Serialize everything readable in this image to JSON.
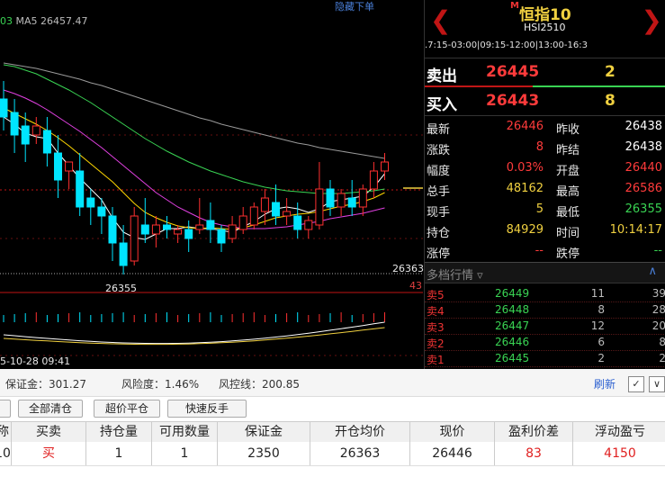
{
  "chart": {
    "ma_legend_prefix": "03",
    "ma_legend_ma5": "MA5 26457.47",
    "hide_link": "隐藏下单",
    "price_marker": "26363",
    "volume_marker": "43",
    "low_label": "26355",
    "datetime": "5-10-28 09:41",
    "colors": {
      "up": "#ff3030",
      "down": "#00e5ff",
      "ma5": "#ffffff",
      "ma10": "#ffd700",
      "ma20": "#e040e0",
      "ma40": "#39d353",
      "ma60": "#9a9a9a"
    }
  },
  "chart_data": {
    "type": "candlestick",
    "title": "恒指10",
    "ylim": [
      26320,
      26620
    ],
    "candles": [
      {
        "o": 26540,
        "h": 26560,
        "c": 26520,
        "l": 26505
      },
      {
        "o": 26525,
        "h": 26540,
        "c": 26500,
        "l": 26480
      },
      {
        "o": 26510,
        "h": 26525,
        "c": 26490,
        "l": 26470
      },
      {
        "o": 26500,
        "h": 26520,
        "c": 26510,
        "l": 26490
      },
      {
        "o": 26505,
        "h": 26520,
        "c": 26480,
        "l": 26465
      },
      {
        "o": 26480,
        "h": 26500,
        "c": 26450,
        "l": 26430
      },
      {
        "o": 26460,
        "h": 26470,
        "c": 26470,
        "l": 26440
      },
      {
        "o": 26460,
        "h": 26480,
        "c": 26420,
        "l": 26410
      },
      {
        "o": 26430,
        "h": 26440,
        "c": 26420,
        "l": 26400
      },
      {
        "o": 26420,
        "h": 26430,
        "c": 26410,
        "l": 26390
      },
      {
        "o": 26410,
        "h": 26420,
        "c": 26380,
        "l": 26360
      },
      {
        "o": 26380,
        "h": 26400,
        "c": 26355,
        "l": 26345
      },
      {
        "o": 26360,
        "h": 26420,
        "c": 26410,
        "l": 26355
      },
      {
        "o": 26400,
        "h": 26430,
        "c": 26390,
        "l": 26380
      },
      {
        "o": 26390,
        "h": 26410,
        "c": 26400,
        "l": 26375
      },
      {
        "o": 26400,
        "h": 26410,
        "c": 26395,
        "l": 26385
      },
      {
        "o": 26390,
        "h": 26400,
        "c": 26395,
        "l": 26380
      },
      {
        "o": 26395,
        "h": 26405,
        "c": 26385,
        "l": 26370
      },
      {
        "o": 26395,
        "h": 26430,
        "c": 26400,
        "l": 26390
      },
      {
        "o": 26405,
        "h": 26425,
        "c": 26395,
        "l": 26380
      },
      {
        "o": 26395,
        "h": 26400,
        "c": 26380,
        "l": 26370
      },
      {
        "o": 26385,
        "h": 26410,
        "c": 26400,
        "l": 26380
      },
      {
        "o": 26395,
        "h": 26420,
        "c": 26410,
        "l": 26390
      },
      {
        "o": 26400,
        "h": 26425,
        "c": 26420,
        "l": 26395
      },
      {
        "o": 26415,
        "h": 26440,
        "c": 26430,
        "l": 26400
      },
      {
        "o": 26425,
        "h": 26445,
        "c": 26410,
        "l": 26400
      },
      {
        "o": 26410,
        "h": 26430,
        "c": 26415,
        "l": 26400
      },
      {
        "o": 26410,
        "h": 26425,
        "c": 26395,
        "l": 26385
      },
      {
        "o": 26395,
        "h": 26410,
        "c": 26405,
        "l": 26385
      },
      {
        "o": 26400,
        "h": 26470,
        "c": 26440,
        "l": 26395
      },
      {
        "o": 26440,
        "h": 26450,
        "c": 26420,
        "l": 26410
      },
      {
        "o": 26420,
        "h": 26440,
        "c": 26435,
        "l": 26410
      },
      {
        "o": 26430,
        "h": 26450,
        "c": 26420,
        "l": 26410
      },
      {
        "o": 26420,
        "h": 26445,
        "c": 26440,
        "l": 26410
      },
      {
        "o": 26440,
        "h": 26470,
        "c": 26460,
        "l": 26430
      },
      {
        "o": 26460,
        "h": 26480,
        "c": 26470,
        "l": 26450
      }
    ],
    "series": [
      {
        "name": "MA5",
        "values": [
          26520,
          26512,
          26502,
          26498,
          26496,
          26480,
          26466,
          26452,
          26440,
          26428,
          26408,
          26392,
          26386,
          26384,
          26390,
          26396,
          26396,
          26398,
          26396,
          26396,
          26394,
          26392,
          26398,
          26404,
          26412,
          26418,
          26420,
          26418,
          26414,
          26418,
          26426,
          26428,
          26430,
          26432,
          26442,
          26457
        ]
      },
      {
        "name": "MA10",
        "values": [
          26530,
          26524,
          26518,
          26512,
          26505,
          26497,
          26488,
          26478,
          26468,
          26458,
          26448,
          26436,
          26424,
          26414,
          26408,
          26403,
          26399,
          26397,
          26396,
          26397,
          26396,
          26395,
          26397,
          26400,
          26404,
          26408,
          26410,
          26412,
          26413,
          26415,
          26418,
          26421,
          26423,
          26426,
          26430,
          26436
        ]
      },
      {
        "name": "MA20",
        "values": [
          26550,
          26546,
          26541,
          26535,
          26528,
          26520,
          26512,
          26504,
          26495,
          26486,
          26476,
          26466,
          26456,
          26446,
          26436,
          26428,
          26420,
          26414,
          26408,
          26403,
          26400,
          26398,
          26396,
          26396,
          26396,
          26397,
          26398,
          26400,
          26402,
          26404,
          26407,
          26409,
          26411,
          26413,
          26416,
          26419
        ]
      },
      {
        "name": "MA40",
        "values": [
          26578,
          26576,
          26572,
          26568,
          26562,
          26556,
          26550,
          26543,
          26536,
          26528,
          26520,
          26512,
          26504,
          26496,
          26489,
          26482,
          26476,
          26470,
          26465,
          26460,
          26456,
          26452,
          26448,
          26445,
          26442,
          26440,
          26438,
          26437,
          26436,
          26435,
          26435,
          26435,
          26436,
          26437,
          26438,
          26440
        ]
      },
      {
        "name": "MA60",
        "values": [
          26580,
          26578,
          26576,
          26574,
          26571,
          26568,
          26565,
          26562,
          26558,
          26555,
          26551,
          26547,
          26543,
          26539,
          26535,
          26531,
          26527,
          26523,
          26519,
          26516,
          26512,
          26509,
          26506,
          26503,
          26500,
          26497,
          26494,
          26491,
          26489,
          26486,
          26484,
          26482,
          26480,
          26478,
          26476,
          26474
        ]
      }
    ]
  },
  "panel": {
    "product_flag": "M",
    "product_name": "恒指10",
    "product_code": "HSI2510",
    "sessions": ".7:15-03:00|09:15-12:00|13:00-16:3",
    "sell": {
      "label": "卖出",
      "price": "26445",
      "qty": "2"
    },
    "buy": {
      "label": "买入",
      "price": "26443",
      "qty": "8"
    },
    "quote_rows": [
      {
        "k1": "最新",
        "v1": "26446",
        "c1": "#ff3b3b",
        "k2": "昨收",
        "v2": "26438",
        "c2": "#ffffff"
      },
      {
        "k1": "涨跌",
        "v1": "8",
        "c1": "#ff3b3b",
        "k2": "昨结",
        "v2": "26438",
        "c2": "#ffffff"
      },
      {
        "k1": "幅度",
        "v1": "0.03%",
        "c1": "#ff3b3b",
        "k2": "开盘",
        "v2": "26440",
        "c2": "#ff3b3b"
      },
      {
        "k1": "总手",
        "v1": "48162",
        "c1": "#f0d040",
        "k2": "最高",
        "v2": "26586",
        "c2": "#ff3b3b"
      },
      {
        "k1": "现手",
        "v1": "5",
        "c1": "#f0d040",
        "k2": "最低",
        "v2": "26355",
        "c2": "#39d353"
      },
      {
        "k1": "持仓",
        "v1": "84929",
        "c1": "#f0d040",
        "k2": "时间",
        "v2": "10:14:17",
        "c2": "#f0d040"
      },
      {
        "k1": "涨停",
        "v1": "--",
        "c1": "#ff3b3b",
        "k2": "跌停",
        "v2": "--",
        "c2": "#39d353"
      }
    ],
    "depth_title": "多档行情",
    "depth_rows": [
      {
        "label": "卖5",
        "price": "26449",
        "qty": "11",
        "cum": "39"
      },
      {
        "label": "卖4",
        "price": "26448",
        "qty": "8",
        "cum": "28"
      },
      {
        "label": "卖3",
        "price": "26447",
        "qty": "12",
        "cum": "20"
      },
      {
        "label": "卖2",
        "price": "26446",
        "qty": "6",
        "cum": "8"
      },
      {
        "label": "卖1",
        "price": "26445",
        "qty": "2",
        "cum": "2"
      }
    ]
  },
  "account": {
    "margin_label": "保证金：301.27",
    "risk_label": "风险度：1.46%",
    "control_label": "风控线：200.85",
    "refresh": "刷新"
  },
  "buttons": {
    "close_all": "全部清仓",
    "over_price_close": "超价平仓",
    "quick_reverse": "快速反手"
  },
  "table": {
    "headers": [
      "称",
      "买卖",
      "持仓量",
      "可用数量",
      "保证金",
      "开仓均价",
      "现价",
      "盈利价差",
      "浮动盈亏"
    ],
    "row": [
      "10",
      "买",
      "1",
      "1",
      "2350",
      "26363",
      "26446",
      "83",
      "4150"
    ]
  }
}
